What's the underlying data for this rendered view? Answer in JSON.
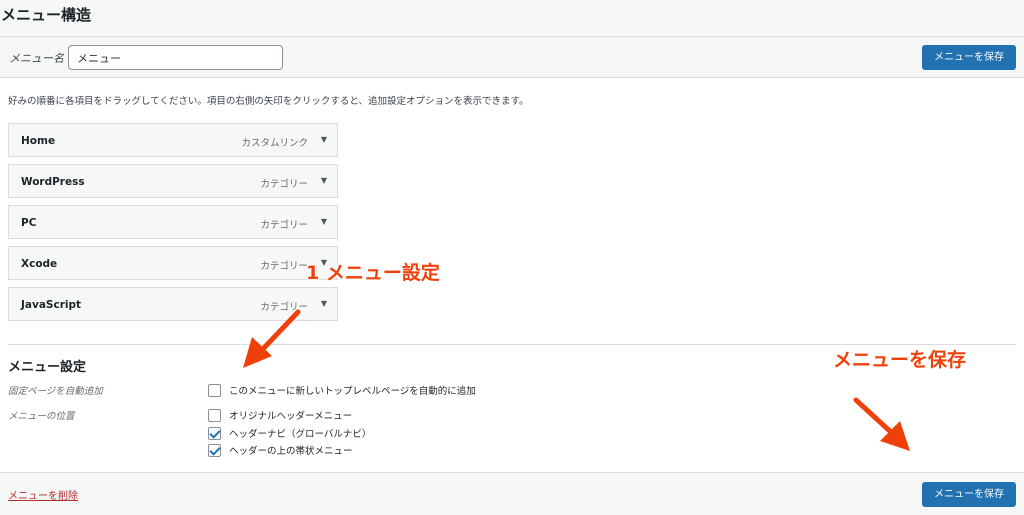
{
  "page": {
    "title": "メニュー構造"
  },
  "header": {
    "menu_name_label": "メニュー名",
    "menu_name_value": "メニュー",
    "save_label": "メニューを保存"
  },
  "instructions": "好みの順番に各項目をドラッグしてください。項目の右側の矢印をクリックすると、追加設定オプションを表示できます。",
  "menu_items": [
    {
      "title": "Home",
      "type": "カスタムリンク"
    },
    {
      "title": "WordPress",
      "type": "カテゴリー"
    },
    {
      "title": "PC",
      "type": "カテゴリー"
    },
    {
      "title": "Xcode",
      "type": "カテゴリー"
    },
    {
      "title": "JavaScript",
      "type": "カテゴリー"
    }
  ],
  "settings": {
    "heading": "メニュー設定",
    "auto_add_label": "固定ページを自動追加",
    "auto_add_option": {
      "text": "このメニューに新しいトップレベルページを自動的に追加",
      "checked": false
    },
    "location_label": "メニューの位置",
    "locations": [
      {
        "text": "オリジナルヘッダーメニュー",
        "checked": false
      },
      {
        "text": "ヘッダーナビ（グローバルナビ）",
        "checked": true
      },
      {
        "text": "ヘッダーの上の帯状メニュー",
        "checked": true
      }
    ]
  },
  "footer": {
    "delete_label": "メニューを削除",
    "save_label": "メニューを保存"
  },
  "annotations": {
    "menu_settings": "1 メニュー設定",
    "save_menu": "メニューを保存",
    "color": "#f0400a"
  },
  "colors": {
    "primary_button": "#2271b1",
    "delete_link": "#b32d2e",
    "bar_background": "#f6f7f7"
  }
}
